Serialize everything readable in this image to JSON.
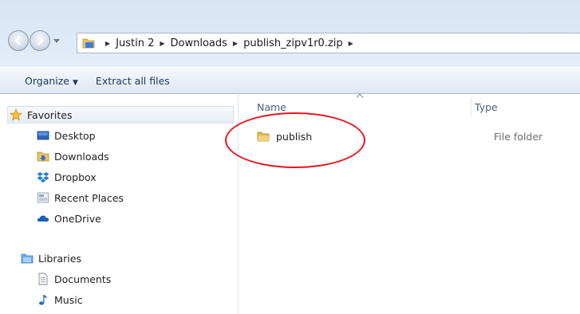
{
  "address_bar": {
    "breadcrumbs": [
      "Justin 2",
      "Downloads",
      "publish_zipv1r0.zip"
    ]
  },
  "toolbar": {
    "organize_label": "Organize",
    "extract_label": "Extract all files"
  },
  "nav_pane": {
    "favorites": {
      "label": "Favorites",
      "items": [
        {
          "label": "Desktop",
          "icon": "desktop-icon"
        },
        {
          "label": "Downloads",
          "icon": "downloads-folder-icon"
        },
        {
          "label": "Dropbox",
          "icon": "dropbox-icon"
        },
        {
          "label": "Recent Places",
          "icon": "recent-places-icon"
        },
        {
          "label": "OneDrive",
          "icon": "onedrive-icon"
        }
      ]
    },
    "libraries": {
      "label": "Libraries",
      "items": [
        {
          "label": "Documents",
          "icon": "document-icon"
        },
        {
          "label": "Music",
          "icon": "music-note-icon"
        }
      ]
    }
  },
  "file_list": {
    "columns": [
      "Name",
      "Type"
    ],
    "rows": [
      {
        "name": "publish",
        "type": "File folder",
        "icon": "folder-icon"
      }
    ]
  },
  "annotation": {
    "color": "#e8141c",
    "shape": "ellipse around publish folder"
  }
}
